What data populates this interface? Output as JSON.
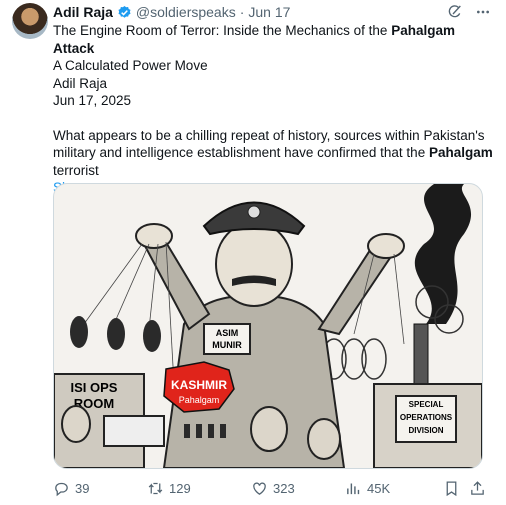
{
  "tweet": {
    "author_name": "Adil Raja",
    "handle": "@soldierspeaks",
    "separator": "·",
    "date": "Jun 17",
    "line1_pre": "The Engine Room of Terror: Inside the Mechanics of the ",
    "line1_bold": "Pahalgam Attack",
    "line2": "A Calculated Power Move",
    "line3": "Adil Raja",
    "line4": "Jun 17, 2025",
    "para_pre": "What appears to be a chilling repeat of history, sources within Pakistan's military and intelligence establishment have confirmed that the ",
    "para_bold": "Pahalgam",
    "para_post": " terrorist",
    "show_more": "Show more"
  },
  "image": {
    "label_general": "ASIM MUNIR",
    "label_isi": "ISI OPS ROOM",
    "label_kashmir": "KASHMIR",
    "label_pahalgam": "Pahalgam",
    "label_special": "SPECIAL OPERATIONS DIVISION"
  },
  "actions": {
    "replies": "39",
    "reposts": "129",
    "likes": "323",
    "views": "45K"
  },
  "colors": {
    "link": "#1d9bf0",
    "secondary": "#536471",
    "kashmir_red": "#e0241b"
  }
}
